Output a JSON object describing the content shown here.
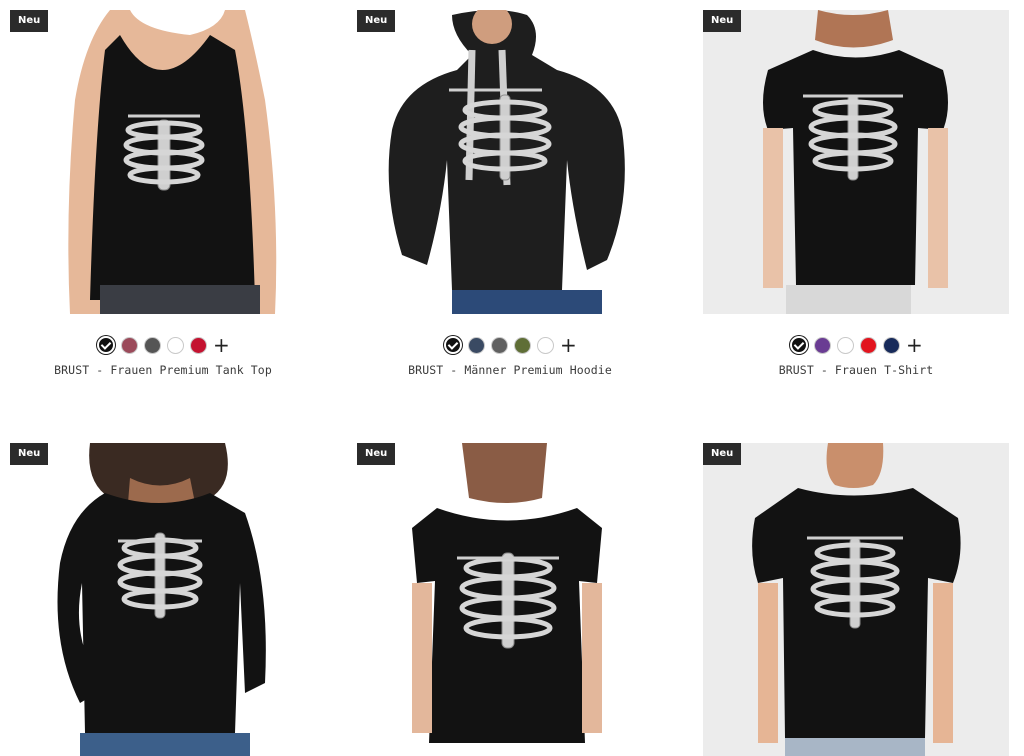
{
  "badge_label": "Neu",
  "more_colors_label": "+",
  "products": [
    {
      "title": "BRUST - Frauen Premium Tank Top",
      "colors": [
        "#111111",
        "#9b4a5a",
        "#555555",
        "#ffffff",
        "#c41230"
      ]
    },
    {
      "title": "BRUST - Männer Premium Hoodie",
      "colors": [
        "#111111",
        "#3a4a63",
        "#606060",
        "#5f6e36",
        "#ffffff"
      ]
    },
    {
      "title": "BRUST - Frauen T-Shirt",
      "colors": [
        "#111111",
        "#6a3c93",
        "#ffffff",
        "#e2141e",
        "#172a5a"
      ]
    },
    {
      "title": ""
    },
    {
      "title": ""
    },
    {
      "title": ""
    }
  ]
}
